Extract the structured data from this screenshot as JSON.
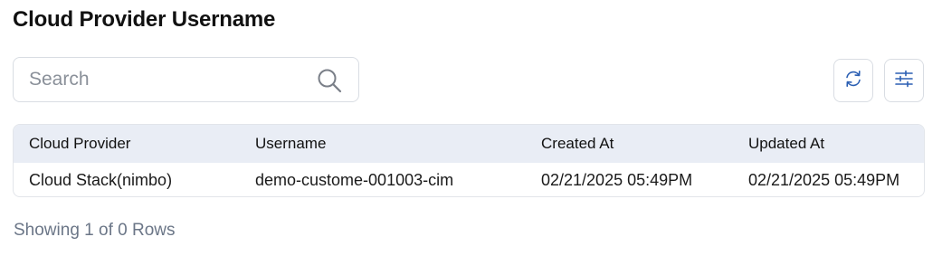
{
  "page": {
    "title": "Cloud Provider Username"
  },
  "search": {
    "placeholder": "Search",
    "value": "",
    "icon": "search-icon"
  },
  "toolbar": {
    "refresh_icon": "refresh-icon",
    "settings_icon": "sliders-icon",
    "icon_color": "#2b5fb3"
  },
  "table": {
    "columns": [
      "Cloud Provider",
      "Username",
      "Created At",
      "Updated At"
    ],
    "rows": [
      {
        "cloud_provider": "Cloud Stack(nimbo)",
        "username": "demo-custome-001003-cim",
        "created_at": "02/21/2025 05:49PM",
        "updated_at": "02/21/2025 05:49PM"
      }
    ]
  },
  "footer": {
    "summary": "Showing 1 of 0 Rows"
  }
}
